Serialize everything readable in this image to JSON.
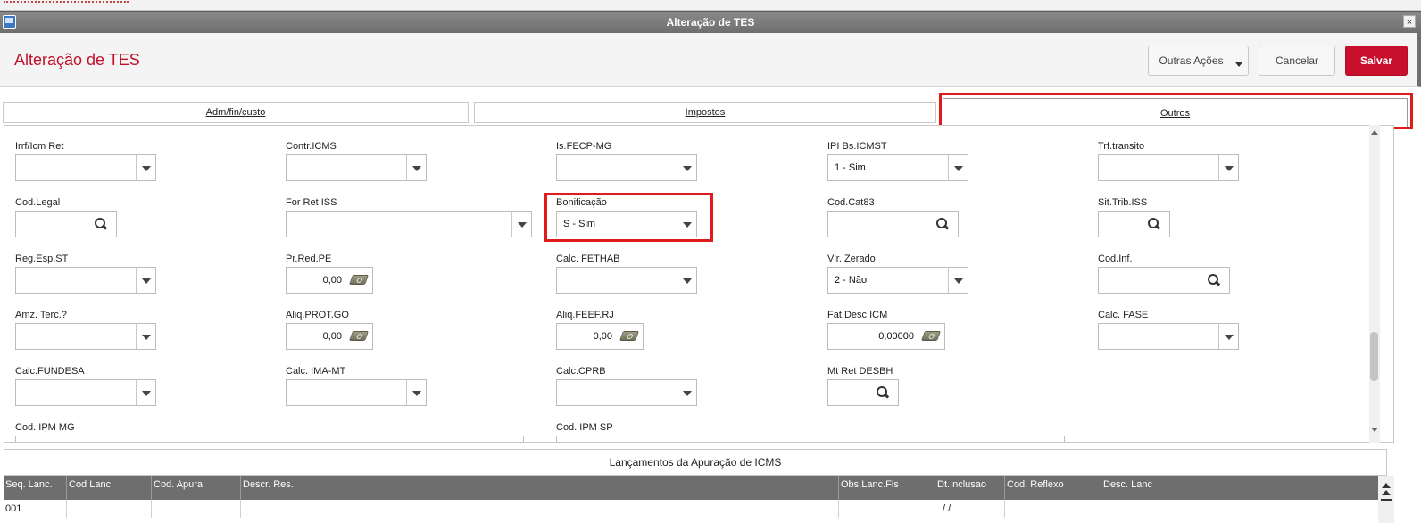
{
  "window": {
    "title": "Alteração de TES",
    "close_label": "×"
  },
  "header": {
    "title": "Alteração de TES",
    "more_actions_label": "Outras Ações",
    "cancel_label": "Cancelar",
    "save_label": "Salvar"
  },
  "tabs": [
    {
      "label": "Adm/fin/custo"
    },
    {
      "label": "Impostos"
    },
    {
      "label": "Outros",
      "active": true
    }
  ],
  "fields": {
    "irrf_icm_ret": {
      "label": "Irrf/Icm Ret",
      "value": ""
    },
    "contr_icms": {
      "label": "Contr.ICMS",
      "value": ""
    },
    "is_fecp_mg": {
      "label": "Is.FECP-MG",
      "value": ""
    },
    "ipi_bs_icmst": {
      "label": "IPI Bs.ICMST",
      "value": "1 - Sim"
    },
    "trf_transito": {
      "label": "Trf.transito",
      "value": ""
    },
    "cod_legal": {
      "label": "Cod.Legal",
      "value": ""
    },
    "for_ret_iss": {
      "label": "For Ret ISS",
      "value": ""
    },
    "bonificacao": {
      "label": "Bonificação",
      "value": "S - Sim"
    },
    "cod_cat83": {
      "label": "Cod.Cat83",
      "value": ""
    },
    "sit_trib_iss": {
      "label": "Sit.Trib.ISS",
      "value": ""
    },
    "reg_esp_st": {
      "label": "Reg.Esp.ST",
      "value": ""
    },
    "pr_red_pe": {
      "label": "Pr.Red.PE",
      "value": "0,00"
    },
    "calc_fethab": {
      "label": "Calc. FETHAB",
      "value": ""
    },
    "vlr_zerado": {
      "label": "Vlr. Zerado",
      "value": "2 - Não"
    },
    "cod_inf": {
      "label": "Cod.Inf.",
      "value": ""
    },
    "amz_terc": {
      "label": "Amz. Terc.?",
      "value": ""
    },
    "aliq_prot_go": {
      "label": "Aliq.PROT.GO",
      "value": "0,00"
    },
    "aliq_feef_rj": {
      "label": "Aliq.FEEF.RJ",
      "value": "0,00"
    },
    "fat_desc_icm": {
      "label": "Fat.Desc.ICM",
      "value": "0,00000"
    },
    "calc_fase": {
      "label": "Calc. FASE",
      "value": ""
    },
    "calc_fundesa": {
      "label": "Calc.FUNDESA",
      "value": ""
    },
    "calc_ima_mt": {
      "label": "Calc. IMA-MT",
      "value": ""
    },
    "calc_cprb": {
      "label": "Calc.CPRB",
      "value": ""
    },
    "mt_ret_desbh": {
      "label": "Mt Ret DESBH",
      "value": ""
    },
    "cod_ipm_mg": {
      "label": "Cod. IPM MG",
      "value": ""
    },
    "cod_ipm_sp": {
      "label": "Cod. IPM SP",
      "value": ""
    }
  },
  "table": {
    "title": "Lançamentos da Apuração de ICMS",
    "columns": [
      "Seq. Lanc.",
      "Cod Lanc",
      "Cod. Apura.",
      "Descr. Res.",
      "Obs.Lanc.Fis",
      "Dt.Inclusao",
      "Cod. Reflexo",
      "Desc. Lanc"
    ],
    "rows": [
      [
        "001",
        "",
        "",
        "",
        "",
        " /  / ",
        "",
        ""
      ]
    ]
  },
  "colors": {
    "accent_red": "#c8102e",
    "titlebar_gray": "#6e6e6e",
    "highlight": "#e01b1b"
  }
}
